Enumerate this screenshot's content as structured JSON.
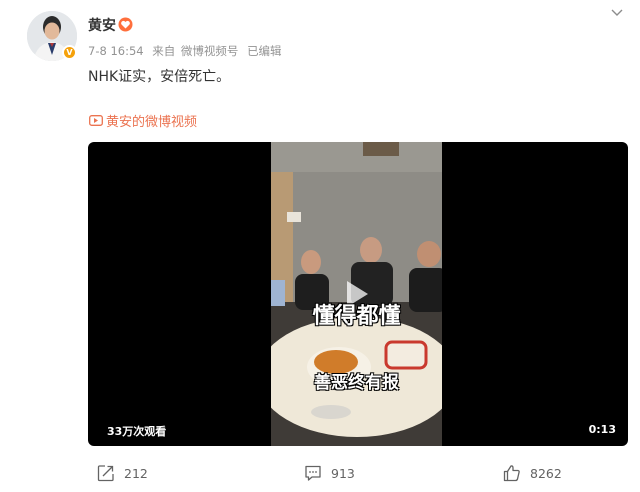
{
  "post": {
    "author": "黄安",
    "time": "7-8 16:54",
    "source_prefix": "来自",
    "source": "微博视频号",
    "edited": "已编辑",
    "text": "NHK证实，安倍死亡。",
    "video_link": "黄安的微博视频"
  },
  "video": {
    "caption_top": "懂得都懂",
    "caption_bottom": "善恶终有报",
    "views": "33万次观看",
    "duration": "0:13"
  },
  "actions": {
    "repost_count": "212",
    "comment_count": "913",
    "like_count": "8262"
  },
  "colors": {
    "accent": "#eb7350",
    "verified": "#f5a10a"
  },
  "icons": [
    "chevron-down-icon",
    "vip-heart-icon",
    "video-icon",
    "play-icon",
    "repost-icon",
    "comment-icon",
    "like-icon"
  ]
}
